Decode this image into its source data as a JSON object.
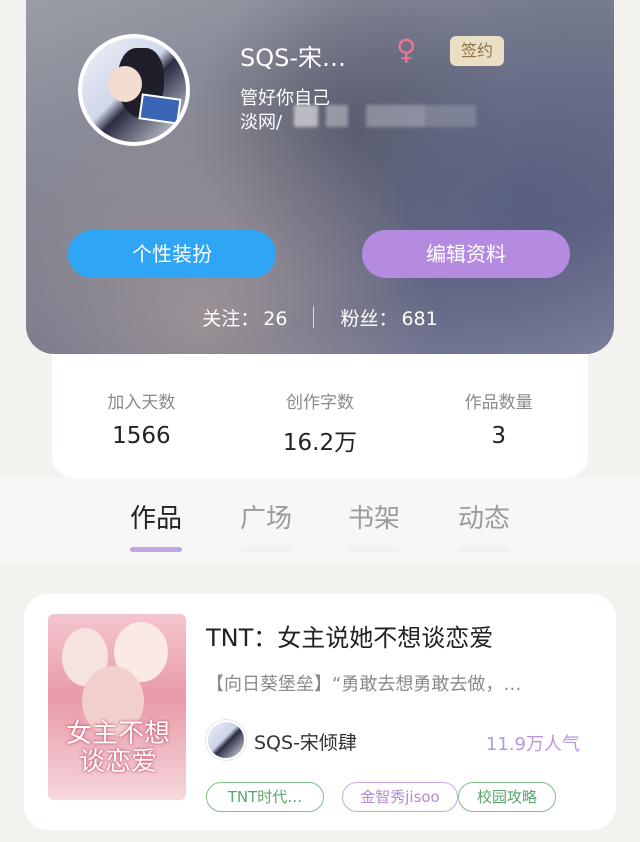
{
  "profile": {
    "nickname": "SQS-宋…",
    "gender_symbol": "♀",
    "badge": "签约",
    "bio": "管好你自己",
    "sub_prefix": "淡网/",
    "buttons": {
      "dressup": "个性装扮",
      "edit": "编辑资料"
    },
    "follow": {
      "label": "关注：",
      "value": "26"
    },
    "fans": {
      "label": "粉丝：",
      "value": "681"
    }
  },
  "stats": [
    {
      "label": "加入天数",
      "value": "1566"
    },
    {
      "label": "创作字数",
      "value": "16.2万"
    },
    {
      "label": "作品数量",
      "value": "3"
    }
  ],
  "tabs": [
    {
      "label": "作品",
      "active": true
    },
    {
      "label": "广场",
      "active": false
    },
    {
      "label": "书架",
      "active": false
    },
    {
      "label": "动态",
      "active": false
    }
  ],
  "book": {
    "title": "TNT：女主说她不想谈恋爱",
    "description": "【向日葵堡垒】“勇敢去想勇敢去做，…",
    "cover_title": "女主不想谈恋爱",
    "author": "SQS-宋倾肆",
    "popularity": "11.9万人气",
    "tags": [
      "TNT时代…",
      "金智秀jisoo",
      "校园攻略"
    ]
  },
  "colors": {
    "blue_button": "#2ea6f5",
    "purple_button": "#b58be2",
    "tab_indicator": "#c0a6e6",
    "tag_green": "#5aa66a",
    "tag_purple": "#b38ad9",
    "badge_bg": "#eadfc4"
  }
}
